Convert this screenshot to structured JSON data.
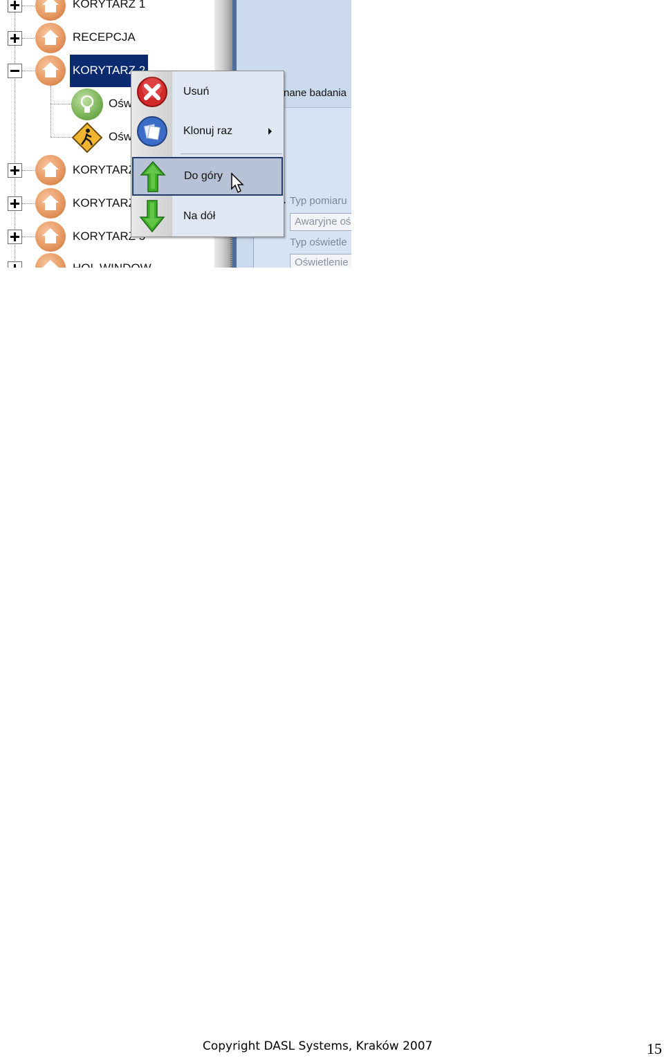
{
  "tree": {
    "items": [
      {
        "label": "KORYTARZ 1",
        "expander": "plus"
      },
      {
        "label": "RECEPCJA",
        "expander": "plus"
      },
      {
        "label": "KORYTARZ 2",
        "expander": "minus",
        "selected": true
      },
      {
        "label": "Ośw",
        "child": true,
        "icon": "lightbulb-icon"
      },
      {
        "label": "Ośw",
        "child": true,
        "icon": "walking-person-warning-icon"
      },
      {
        "label": "KORYTARZ",
        "expander": "plus"
      },
      {
        "label": "KORYTARZ",
        "expander": "plus"
      },
      {
        "label": "KORYTARZ 5",
        "expander": "plus"
      },
      {
        "label": "HOL WINDOW",
        "expander": "plus"
      }
    ]
  },
  "context_menu": {
    "items": [
      {
        "label": "Usuń",
        "icon": "delete-x-icon"
      },
      {
        "label": "Klonuj raz",
        "icon": "clone-icon",
        "has_submenu": true
      },
      {
        "label": "Do góry",
        "icon": "arrow-up-icon",
        "highlighted": true
      },
      {
        "label": "Na dół",
        "icon": "arrow-down-icon"
      }
    ]
  },
  "right_panel": {
    "title": "nane badania",
    "fields": [
      {
        "label": "Typ pomiaru",
        "value": "Awaryjne oś"
      },
      {
        "label": "Typ oświetle",
        "value": "Oświetlenie"
      }
    ]
  },
  "footer": {
    "copyright": "Copyright DASL Systems, Kraków 2007",
    "page_number": "15"
  },
  "colors": {
    "selection": "#0b2a6f",
    "menu_background": "#dfe7f2",
    "menu_highlight": "#b8c2d6",
    "panel_background": "#cbd9ec",
    "orange_button": "#f7a34a"
  }
}
